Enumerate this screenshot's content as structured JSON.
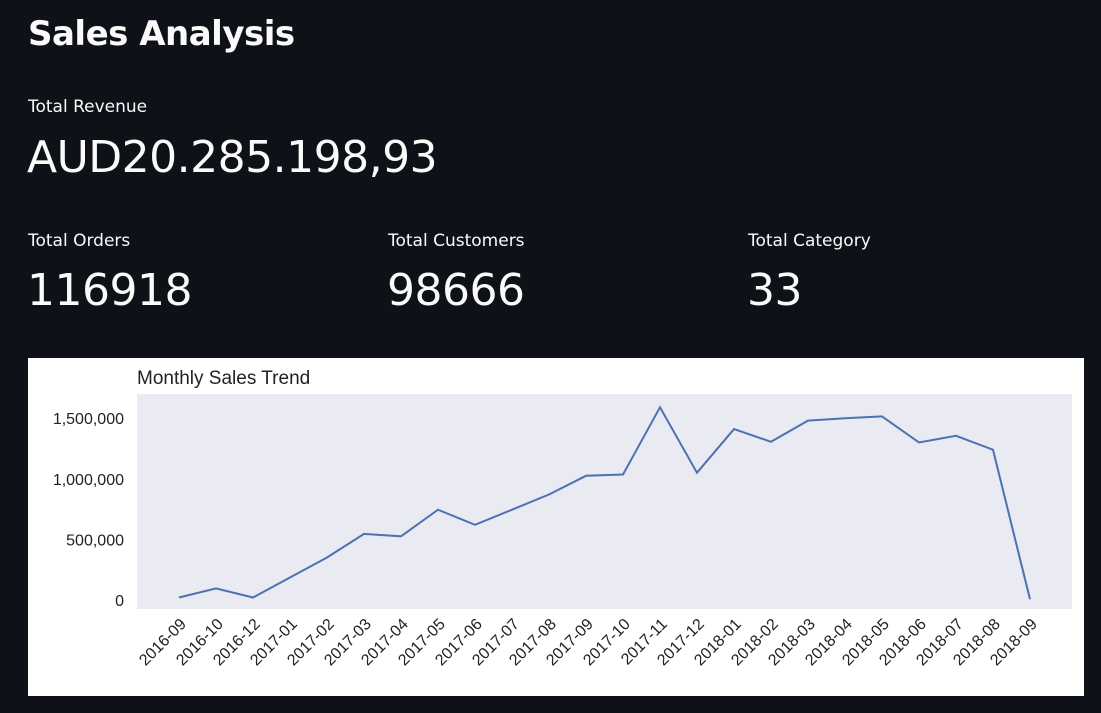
{
  "page": {
    "title": "Sales Analysis"
  },
  "metrics": {
    "revenue": {
      "label": "Total Revenue",
      "value": "AUD20.285.198,93"
    },
    "orders": {
      "label": "Total Orders",
      "value": "116918"
    },
    "customers": {
      "label": "Total Customers",
      "value": "98666"
    },
    "category": {
      "label": "Total Category",
      "value": "33"
    }
  },
  "chart_data": {
    "type": "line",
    "title": "Monthly Sales Trend",
    "xlabel": "",
    "ylabel": "",
    "categories": [
      "2016-09",
      "2016-10",
      "2016-12",
      "2017-01",
      "2017-02",
      "2017-03",
      "2017-04",
      "2017-05",
      "2017-06",
      "2017-07",
      "2017-08",
      "2017-09",
      "2017-10",
      "2017-11",
      "2017-12",
      "2018-01",
      "2018-02",
      "2018-03",
      "2018-04",
      "2018-05",
      "2018-06",
      "2018-07",
      "2018-08",
      "2018-09"
    ],
    "values": [
      20000,
      95000,
      20000,
      185000,
      350000,
      545000,
      525000,
      745000,
      620000,
      745000,
      870000,
      1025000,
      1035000,
      1590000,
      1050000,
      1410000,
      1305000,
      1480000,
      1500000,
      1515000,
      1300000,
      1355000,
      1240000,
      5000
    ],
    "yticks": [
      0,
      500000,
      1000000,
      1500000
    ],
    "ytick_labels": [
      "0",
      "500,000",
      "1,000,000",
      "1,500,000"
    ],
    "ylim": [
      -75000,
      1700000
    ],
    "grid": false,
    "background": "#eaeaf2",
    "line_color": "#4c72b0"
  }
}
